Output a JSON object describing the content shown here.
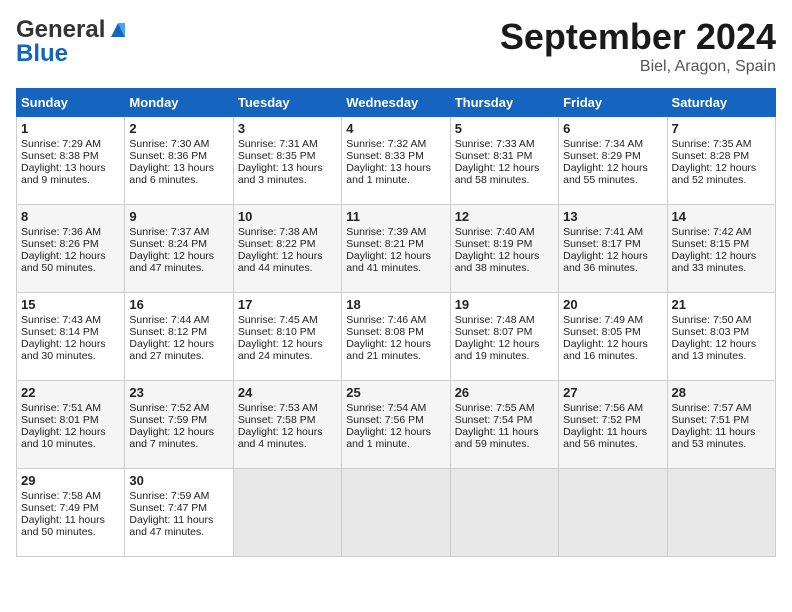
{
  "header": {
    "logo_line1": "General",
    "logo_line2": "Blue",
    "month": "September 2024",
    "location": "Biel, Aragon, Spain"
  },
  "days_of_week": [
    "Sunday",
    "Monday",
    "Tuesday",
    "Wednesday",
    "Thursday",
    "Friday",
    "Saturday"
  ],
  "weeks": [
    [
      {
        "day": "1",
        "lines": [
          "Sunrise: 7:29 AM",
          "Sunset: 8:38 PM",
          "Daylight: 13 hours",
          "and 9 minutes."
        ]
      },
      {
        "day": "2",
        "lines": [
          "Sunrise: 7:30 AM",
          "Sunset: 8:36 PM",
          "Daylight: 13 hours",
          "and 6 minutes."
        ]
      },
      {
        "day": "3",
        "lines": [
          "Sunrise: 7:31 AM",
          "Sunset: 8:35 PM",
          "Daylight: 13 hours",
          "and 3 minutes."
        ]
      },
      {
        "day": "4",
        "lines": [
          "Sunrise: 7:32 AM",
          "Sunset: 8:33 PM",
          "Daylight: 13 hours",
          "and 1 minute."
        ]
      },
      {
        "day": "5",
        "lines": [
          "Sunrise: 7:33 AM",
          "Sunset: 8:31 PM",
          "Daylight: 12 hours",
          "and 58 minutes."
        ]
      },
      {
        "day": "6",
        "lines": [
          "Sunrise: 7:34 AM",
          "Sunset: 8:29 PM",
          "Daylight: 12 hours",
          "and 55 minutes."
        ]
      },
      {
        "day": "7",
        "lines": [
          "Sunrise: 7:35 AM",
          "Sunset: 8:28 PM",
          "Daylight: 12 hours",
          "and 52 minutes."
        ]
      }
    ],
    [
      {
        "day": "8",
        "lines": [
          "Sunrise: 7:36 AM",
          "Sunset: 8:26 PM",
          "Daylight: 12 hours",
          "and 50 minutes."
        ]
      },
      {
        "day": "9",
        "lines": [
          "Sunrise: 7:37 AM",
          "Sunset: 8:24 PM",
          "Daylight: 12 hours",
          "and 47 minutes."
        ]
      },
      {
        "day": "10",
        "lines": [
          "Sunrise: 7:38 AM",
          "Sunset: 8:22 PM",
          "Daylight: 12 hours",
          "and 44 minutes."
        ]
      },
      {
        "day": "11",
        "lines": [
          "Sunrise: 7:39 AM",
          "Sunset: 8:21 PM",
          "Daylight: 12 hours",
          "and 41 minutes."
        ]
      },
      {
        "day": "12",
        "lines": [
          "Sunrise: 7:40 AM",
          "Sunset: 8:19 PM",
          "Daylight: 12 hours",
          "and 38 minutes."
        ]
      },
      {
        "day": "13",
        "lines": [
          "Sunrise: 7:41 AM",
          "Sunset: 8:17 PM",
          "Daylight: 12 hours",
          "and 36 minutes."
        ]
      },
      {
        "day": "14",
        "lines": [
          "Sunrise: 7:42 AM",
          "Sunset: 8:15 PM",
          "Daylight: 12 hours",
          "and 33 minutes."
        ]
      }
    ],
    [
      {
        "day": "15",
        "lines": [
          "Sunrise: 7:43 AM",
          "Sunset: 8:14 PM",
          "Daylight: 12 hours",
          "and 30 minutes."
        ]
      },
      {
        "day": "16",
        "lines": [
          "Sunrise: 7:44 AM",
          "Sunset: 8:12 PM",
          "Daylight: 12 hours",
          "and 27 minutes."
        ]
      },
      {
        "day": "17",
        "lines": [
          "Sunrise: 7:45 AM",
          "Sunset: 8:10 PM",
          "Daylight: 12 hours",
          "and 24 minutes."
        ]
      },
      {
        "day": "18",
        "lines": [
          "Sunrise: 7:46 AM",
          "Sunset: 8:08 PM",
          "Daylight: 12 hours",
          "and 21 minutes."
        ]
      },
      {
        "day": "19",
        "lines": [
          "Sunrise: 7:48 AM",
          "Sunset: 8:07 PM",
          "Daylight: 12 hours",
          "and 19 minutes."
        ]
      },
      {
        "day": "20",
        "lines": [
          "Sunrise: 7:49 AM",
          "Sunset: 8:05 PM",
          "Daylight: 12 hours",
          "and 16 minutes."
        ]
      },
      {
        "day": "21",
        "lines": [
          "Sunrise: 7:50 AM",
          "Sunset: 8:03 PM",
          "Daylight: 12 hours",
          "and 13 minutes."
        ]
      }
    ],
    [
      {
        "day": "22",
        "lines": [
          "Sunrise: 7:51 AM",
          "Sunset: 8:01 PM",
          "Daylight: 12 hours",
          "and 10 minutes."
        ]
      },
      {
        "day": "23",
        "lines": [
          "Sunrise: 7:52 AM",
          "Sunset: 7:59 PM",
          "Daylight: 12 hours",
          "and 7 minutes."
        ]
      },
      {
        "day": "24",
        "lines": [
          "Sunrise: 7:53 AM",
          "Sunset: 7:58 PM",
          "Daylight: 12 hours",
          "and 4 minutes."
        ]
      },
      {
        "day": "25",
        "lines": [
          "Sunrise: 7:54 AM",
          "Sunset: 7:56 PM",
          "Daylight: 12 hours",
          "and 1 minute."
        ]
      },
      {
        "day": "26",
        "lines": [
          "Sunrise: 7:55 AM",
          "Sunset: 7:54 PM",
          "Daylight: 11 hours",
          "and 59 minutes."
        ]
      },
      {
        "day": "27",
        "lines": [
          "Sunrise: 7:56 AM",
          "Sunset: 7:52 PM",
          "Daylight: 11 hours",
          "and 56 minutes."
        ]
      },
      {
        "day": "28",
        "lines": [
          "Sunrise: 7:57 AM",
          "Sunset: 7:51 PM",
          "Daylight: 11 hours",
          "and 53 minutes."
        ]
      }
    ],
    [
      {
        "day": "29",
        "lines": [
          "Sunrise: 7:58 AM",
          "Sunset: 7:49 PM",
          "Daylight: 11 hours",
          "and 50 minutes."
        ]
      },
      {
        "day": "30",
        "lines": [
          "Sunrise: 7:59 AM",
          "Sunset: 7:47 PM",
          "Daylight: 11 hours",
          "and 47 minutes."
        ]
      },
      {
        "day": "",
        "lines": []
      },
      {
        "day": "",
        "lines": []
      },
      {
        "day": "",
        "lines": []
      },
      {
        "day": "",
        "lines": []
      },
      {
        "day": "",
        "lines": []
      }
    ]
  ]
}
